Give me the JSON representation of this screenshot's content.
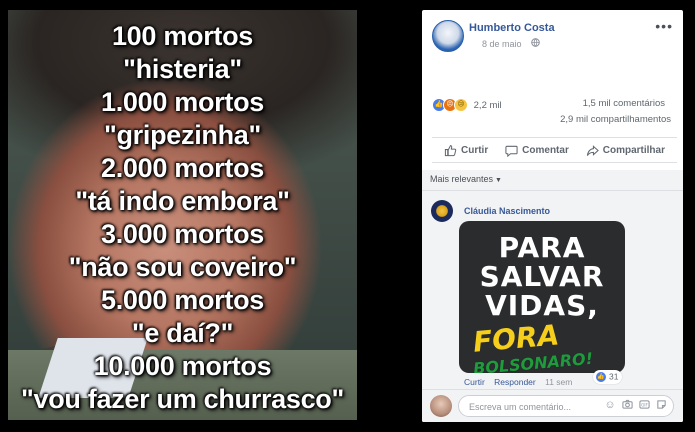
{
  "meme": {
    "lines": [
      "100 mortos",
      "\"histeria\"",
      "1.000 mortos",
      "\"gripezinha\"",
      "2.000 mortos",
      "\"tá indo embora\"",
      "3.000 mortos",
      "\"não sou coveiro\"",
      "5.000 mortos",
      "\"e daí?\"",
      "10.000 mortos",
      "\"vou fazer um churrasco\""
    ]
  },
  "post": {
    "author": "Humberto Costa",
    "date": "8 de maio",
    "privacy_icon": "globe-icon",
    "more_icon": "more-options-icon",
    "reactions_count": "2,2 mil",
    "comments_count": "1,5 mil comentários",
    "shares_count": "2,9 mil compartilhamentos",
    "actions": {
      "like": "Curtir",
      "comment": "Comentar",
      "share": "Compartilhar"
    }
  },
  "comments": {
    "filter_label": "Mais relevantes",
    "items": [
      {
        "author": "Cláudia Nascimento",
        "sticker_lines": [
          "PARA",
          "SALVAR",
          "VIDAS,"
        ],
        "sticker_fora": "FORA",
        "sticker_bolsonaro": "BOLSONARO!",
        "like_label": "Curtir",
        "reply_label": "Responder",
        "time": "11 sem",
        "reaction_count": "31"
      }
    ],
    "composer": {
      "placeholder": "Escreva um comentário..."
    }
  },
  "colors": {
    "fb_blue": "#365899",
    "like_blue": "#4a7ce8",
    "angry_orange": "#e9710f",
    "sad_yellow": "#f6c443",
    "sticker_yellow": "#f6cf1d",
    "sticker_green": "#1f9b3a"
  }
}
